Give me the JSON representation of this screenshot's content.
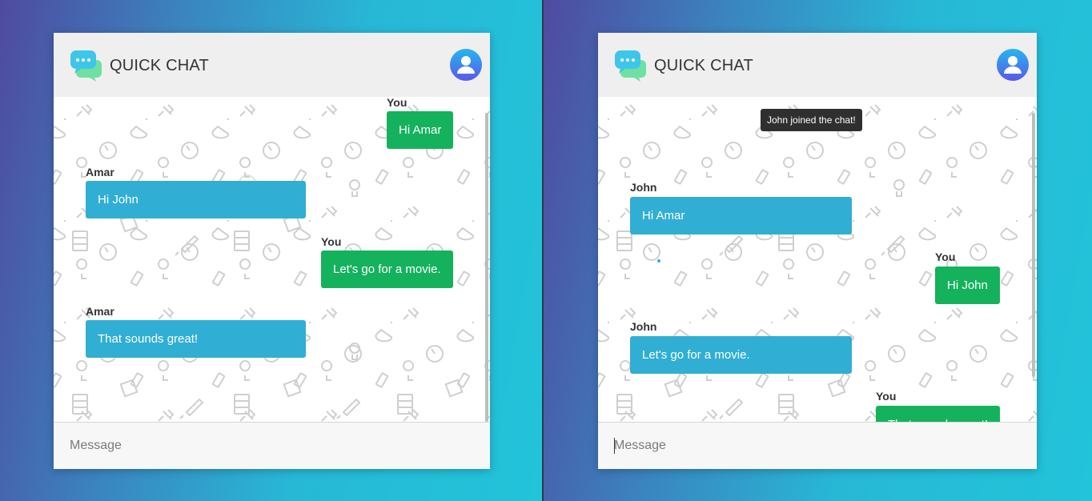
{
  "colors": {
    "gradient_start": "#4f4aa0",
    "gradient_end": "#22c4da",
    "header_bg": "#efefef",
    "bubble_other": "#31aed4",
    "bubble_self": "#14b25c",
    "notice_bg": "#2f2f2f"
  },
  "icons": [
    "chat-bubbles-logo-icon",
    "user-avatar-icon",
    "background-pattern"
  ],
  "left_window": {
    "title": "QUICK CHAT",
    "messages": [
      {
        "sender": "You",
        "text": "Hi Amar",
        "self": true
      },
      {
        "sender": "Amar",
        "text": "Hi John",
        "self": false
      },
      {
        "sender": "You",
        "text": "Let's go for a movie.",
        "self": true
      },
      {
        "sender": "Amar",
        "text": "That sounds great!",
        "self": false
      }
    ],
    "input": {
      "value": "",
      "placeholder": "Message"
    }
  },
  "right_window": {
    "title": "QUICK CHAT",
    "notice": "John joined the chat!",
    "messages": [
      {
        "sender": "John",
        "text": "Hi Amar",
        "self": false
      },
      {
        "sender": "You",
        "text": "Hi John",
        "self": true
      },
      {
        "sender": "John",
        "text": "Let's go for a movie.",
        "self": false
      },
      {
        "sender": "You",
        "text": "That sounds great!",
        "self": true
      }
    ],
    "input": {
      "value": "",
      "placeholder": "Message"
    }
  }
}
